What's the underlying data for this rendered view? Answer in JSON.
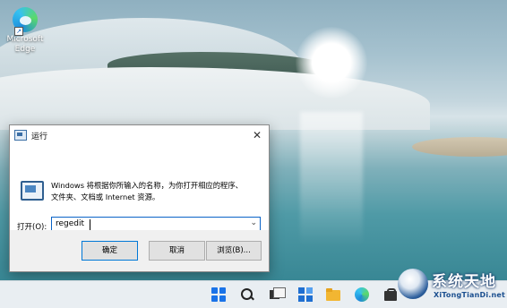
{
  "desktop": {
    "icons": [
      {
        "label_line1": "Microsoft",
        "label_line2": "Edge"
      }
    ]
  },
  "run_dialog": {
    "title": "运行",
    "description_line1": "Windows 将根据你所输入的名称，为你打开相应的程序、",
    "description_line2": "文件夹、文档或 Internet 资源。",
    "open_label": "打开(O):",
    "command_value": "regedit",
    "buttons": {
      "ok": "确定",
      "cancel": "取消",
      "browse": "浏览(B)..."
    }
  },
  "taskbar": {
    "icons": [
      "start-icon",
      "search-icon",
      "task-view-icon",
      "widgets-icon",
      "file-explorer-icon",
      "edge-icon",
      "store-icon"
    ]
  },
  "watermark": {
    "title": "系统天地",
    "site": "XiTongTianDi.net"
  }
}
